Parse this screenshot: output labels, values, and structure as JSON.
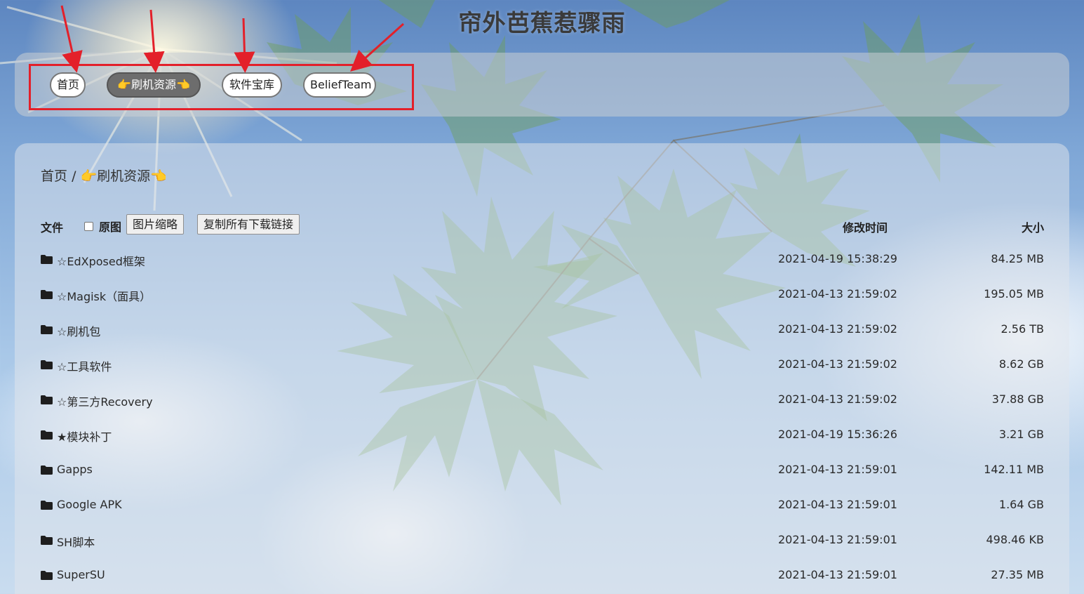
{
  "site": {
    "title": "帘外芭蕉惹骤雨"
  },
  "nav": {
    "items": [
      {
        "label": "首页",
        "active": false
      },
      {
        "label": "👉刷机资源👈",
        "active": true
      },
      {
        "label": "软件宝库",
        "active": false
      },
      {
        "label": "BeliefTeam",
        "active": false
      }
    ]
  },
  "breadcrumb": {
    "home": "首页",
    "separator": "/",
    "current": "👉刷机资源👈"
  },
  "table": {
    "header": {
      "file": "文件",
      "original_label": "原图",
      "thumbnail_button": "图片缩略",
      "copy_links_button": "复制所有下载链接",
      "mtime": "修改时间",
      "size": "大小"
    },
    "rows": [
      {
        "name": "☆EdXposed框架",
        "mtime": "2021-04-19 15:38:29",
        "size": "84.25 MB"
      },
      {
        "name": "☆Magisk（面具）",
        "mtime": "2021-04-13 21:59:02",
        "size": "195.05 MB"
      },
      {
        "name": "☆刷机包",
        "mtime": "2021-04-13 21:59:02",
        "size": "2.56 TB"
      },
      {
        "name": "☆工具软件",
        "mtime": "2021-04-13 21:59:02",
        "size": "8.62 GB"
      },
      {
        "name": "☆第三方Recovery",
        "mtime": "2021-04-13 21:59:02",
        "size": "37.88 GB"
      },
      {
        "name": "★模块补丁",
        "mtime": "2021-04-19 15:36:26",
        "size": "3.21 GB"
      },
      {
        "name": "Gapps",
        "mtime": "2021-04-13 21:59:01",
        "size": "142.11 MB"
      },
      {
        "name": "Google APK",
        "mtime": "2021-04-13 21:59:01",
        "size": "1.64 GB"
      },
      {
        "name": "SH脚本",
        "mtime": "2021-04-13 21:59:01",
        "size": "498.46 KB"
      },
      {
        "name": "SuperSU",
        "mtime": "2021-04-13 21:59:01",
        "size": "27.35 MB"
      }
    ]
  },
  "icons": {
    "folder": "folder-icon",
    "annotation": "red-arrow"
  },
  "colors": {
    "annotation_red": "#e3202a",
    "nav_active_bg": "#6d6d6d",
    "text": "#2a2a2a"
  }
}
